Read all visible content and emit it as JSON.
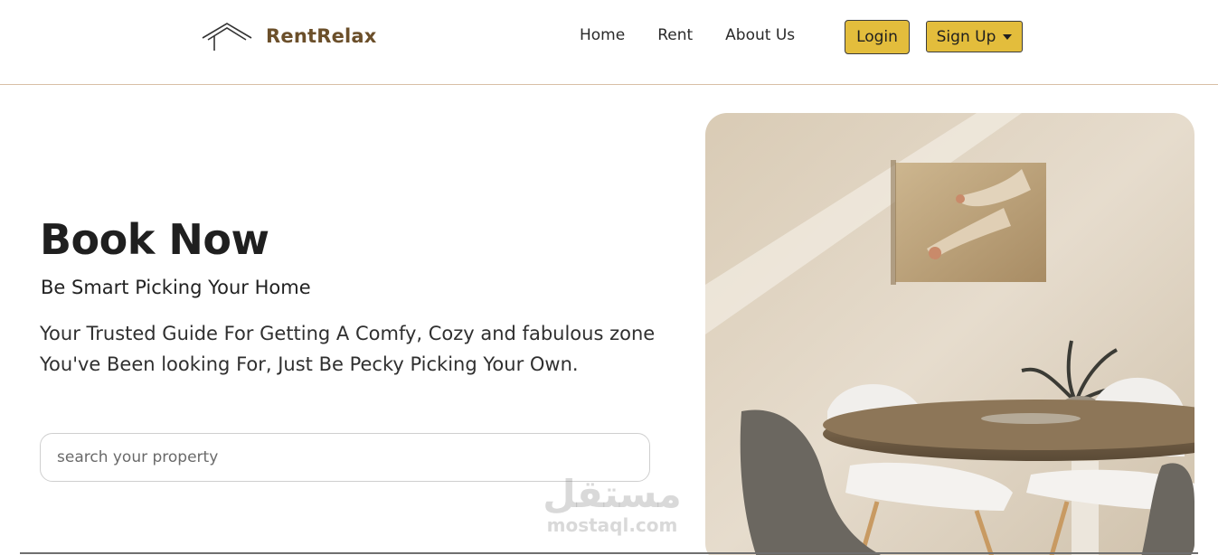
{
  "brand": {
    "name": "RentRelax",
    "logo_icon": "roof-icon"
  },
  "nav": {
    "links": [
      "Home",
      "Rent",
      "About Us"
    ],
    "login_label": "Login",
    "signup_label": "Sign Up"
  },
  "hero": {
    "title": "Book Now",
    "subtitle": "Be Smart Picking Your Home",
    "description": "Your Trusted Guide For Getting A Comfy, Cozy and fabulous zone You've Been looking For, Just Be Pecky Picking Your Own.",
    "search_placeholder": "search your property"
  },
  "watermark": {
    "arabic": "مستقل",
    "latin": "mostaql.com"
  },
  "colors": {
    "accent": "#e3bd3c",
    "brand": "#6b4f2a",
    "divider": "#d9bfa6"
  }
}
